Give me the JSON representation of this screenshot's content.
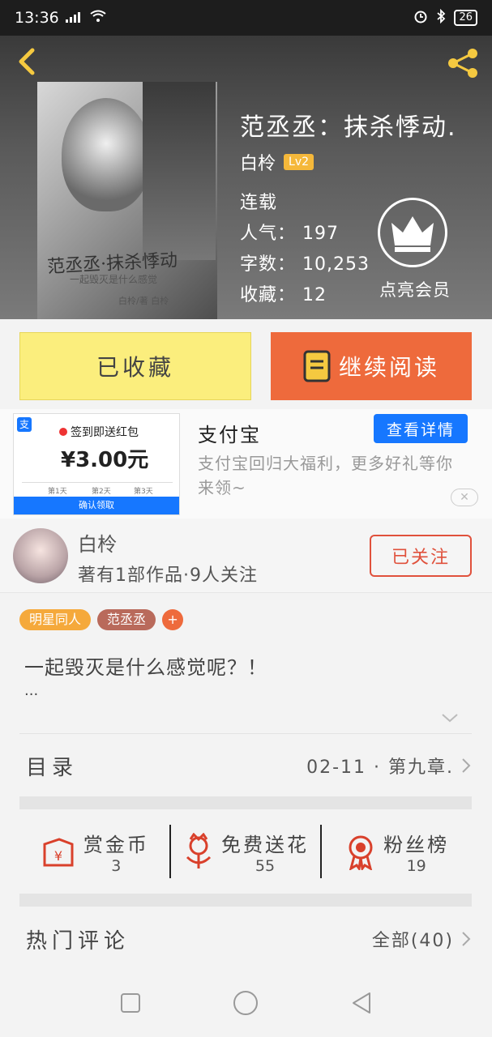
{
  "status_bar": {
    "time": "13:36",
    "signal": "ᵃˡˡ",
    "battery": "26"
  },
  "book": {
    "title": "范丞丞：抹杀悸动.",
    "author": "白柃",
    "author_level": "Lv2",
    "status": "连载",
    "popularity": "人气： 197",
    "words": "字数： 10,253",
    "favorites": "收藏： 12",
    "vip_label": "点亮会员"
  },
  "cover": {
    "title": "范丞丞·抹杀悸动",
    "subtitle": "一起毁灭是什么感觉",
    "author": "白柃/著 白柃"
  },
  "actions": {
    "collected": "已收藏",
    "continue_reading": "继续阅读"
  },
  "ad": {
    "image_title": "签到即送红包",
    "image_amount": "¥3.00元",
    "image_day1": "第1天",
    "image_day2": "第2天",
    "image_day3": "第3天",
    "image_button": "确认领取",
    "title": "支付宝",
    "button": "查看详情",
    "text": "支付宝回归大福利，更多好礼等你来领~",
    "close": "✕"
  },
  "author_info": {
    "name": "白柃",
    "stats": "著有1部作品·9人关注",
    "follow": "已关注"
  },
  "tags": [
    {
      "label": "明星同人",
      "color": "#f5a93b"
    },
    {
      "label": "范丞丞",
      "color": "#b96a5b"
    }
  ],
  "tag_add": "+",
  "description": "一起毁灭是什么感觉呢？！",
  "description_ellipsis": "...",
  "catalog": {
    "label": "目录",
    "latest": "02-11 · 第九章."
  },
  "rewards": [
    {
      "label": "赏金币",
      "value": "3"
    },
    {
      "label": "免费送花",
      "value": "55"
    },
    {
      "label": "粉丝榜",
      "value": "19"
    }
  ],
  "comments": {
    "label": "热门评论",
    "all": "全部(40)"
  },
  "colors": {
    "accent_orange": "#ee6a3c",
    "collected_yellow": "#fbee7d",
    "alipay_blue": "#1677ff",
    "follow_red": "#e0513c"
  }
}
